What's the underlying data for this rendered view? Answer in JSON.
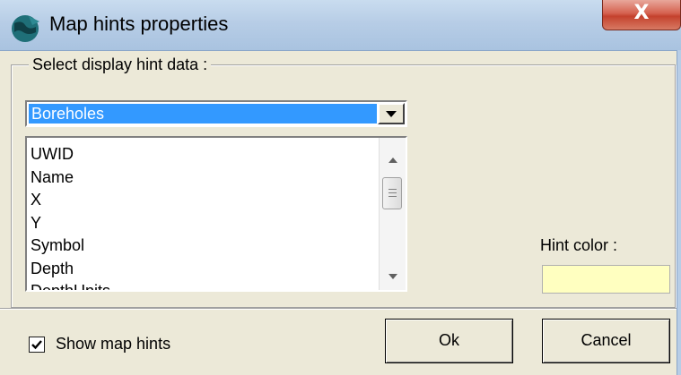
{
  "window": {
    "title": "Map hints properties",
    "close_label": "X",
    "app_icon": "globe-icon"
  },
  "group": {
    "legend": "Select display hint data :"
  },
  "combo": {
    "selected": "Boreholes"
  },
  "fields": {
    "items": [
      "UWID",
      "Name",
      "X",
      "Y",
      "Symbol",
      "Depth",
      "DepthUnits"
    ]
  },
  "hint_color": {
    "label": "Hint color :",
    "value": "#ffffc0"
  },
  "show_hints": {
    "label": "Show map hints",
    "checked": true
  },
  "buttons": {
    "ok": "Ok",
    "cancel": "Cancel"
  }
}
